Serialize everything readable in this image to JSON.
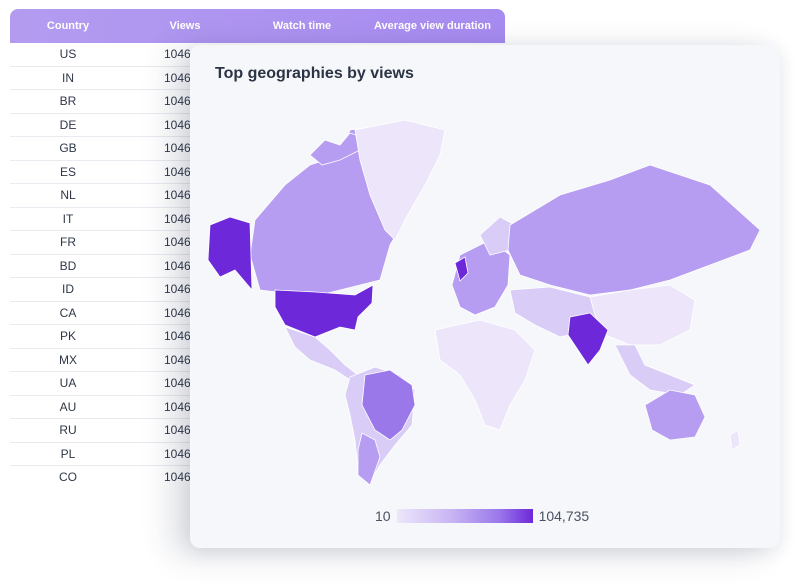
{
  "table": {
    "headers": [
      "Country",
      "Views",
      "Watch time",
      "Average view duration"
    ],
    "rows": [
      {
        "country": "US",
        "views": "1046"
      },
      {
        "country": "IN",
        "views": "1046"
      },
      {
        "country": "BR",
        "views": "1046"
      },
      {
        "country": "DE",
        "views": "1046"
      },
      {
        "country": "GB",
        "views": "1046"
      },
      {
        "country": "ES",
        "views": "1046"
      },
      {
        "country": "NL",
        "views": "1046"
      },
      {
        "country": "IT",
        "views": "1046"
      },
      {
        "country": "FR",
        "views": "1046"
      },
      {
        "country": "BD",
        "views": "1046"
      },
      {
        "country": "ID",
        "views": "1046"
      },
      {
        "country": "CA",
        "views": "1046"
      },
      {
        "country": "PK",
        "views": "1046"
      },
      {
        "country": "MX",
        "views": "1046"
      },
      {
        "country": "UA",
        "views": "1046"
      },
      {
        "country": "AU",
        "views": "1046"
      },
      {
        "country": "RU",
        "views": "1046"
      },
      {
        "country": "PL",
        "views": "1046"
      },
      {
        "country": "CO",
        "views": "1046"
      }
    ]
  },
  "map": {
    "title": "Top geographies by views",
    "legend_min": "10",
    "legend_max": "104,735",
    "colors": {
      "lightest": "#ede6fb",
      "light": "#d9cdf8",
      "medium": "#b69df1",
      "strong": "#9b78ea",
      "darkest": "#6d28d9"
    }
  }
}
